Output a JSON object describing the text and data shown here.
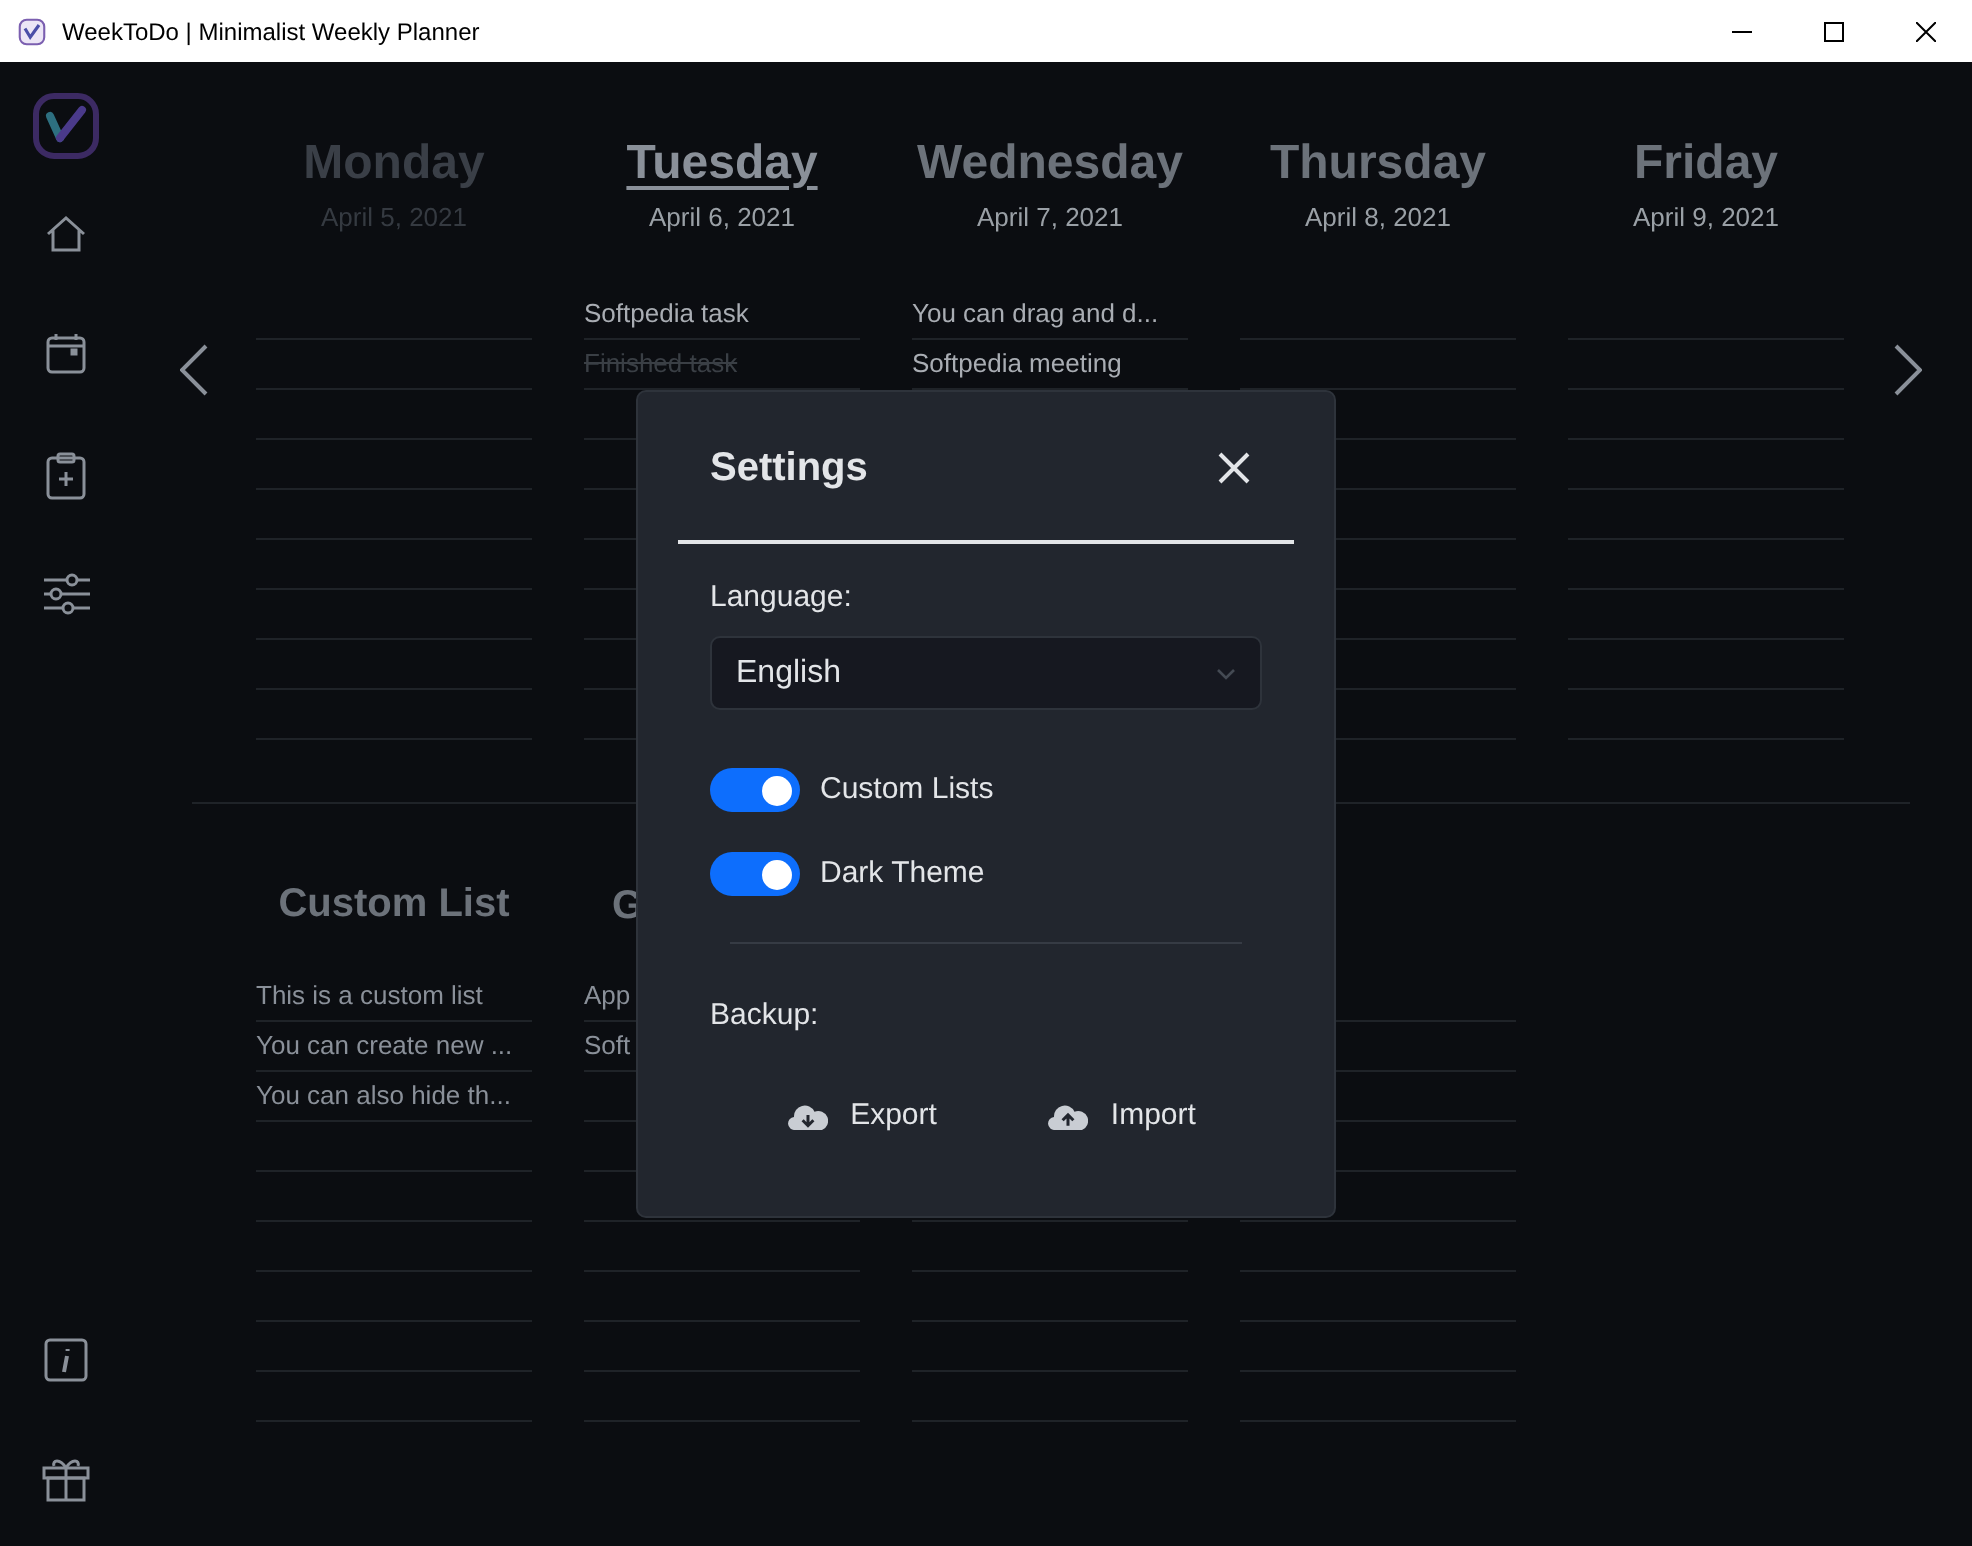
{
  "window": {
    "title": "WeekToDo | Minimalist Weekly Planner"
  },
  "week": {
    "days": [
      {
        "name": "Monday",
        "date": "April 5, 2021",
        "kind": "past"
      },
      {
        "name": "Tuesday",
        "date": "April 6, 2021",
        "kind": "today",
        "tasks": [
          {
            "text": "Softpedia task",
            "done": false
          },
          {
            "text": "Finished task",
            "done": true
          }
        ]
      },
      {
        "name": "Wednesday",
        "date": "April 7, 2021",
        "kind": "upcoming",
        "tasks": [
          {
            "text": "You can drag and d...",
            "done": false
          },
          {
            "text": "Softpedia meeting",
            "done": false
          }
        ]
      },
      {
        "name": "Thursday",
        "date": "April 8, 2021",
        "kind": "upcoming"
      },
      {
        "name": "Friday",
        "date": "April 9, 2021",
        "kind": "upcoming"
      }
    ]
  },
  "custom_lists": [
    {
      "title": "Custom List",
      "tasks": [
        {
          "text": "This is a custom list",
          "done": false
        },
        {
          "text": "You can create new ...",
          "done": false
        },
        {
          "text": "You can also hide th...",
          "done": false
        }
      ]
    },
    {
      "title": "G",
      "tasks": [
        {
          "text": "App",
          "done": false
        },
        {
          "text": "Soft",
          "done": false
        }
      ]
    }
  ],
  "settings_dialog": {
    "title": "Settings",
    "language_label": "Language:",
    "language": "English",
    "toggles": [
      {
        "label": "Custom Lists",
        "on": true
      },
      {
        "label": "Dark Theme",
        "on": true
      }
    ],
    "backup_label": "Backup:",
    "buttons": [
      {
        "label": "Export",
        "kind": "export"
      },
      {
        "label": "Import",
        "kind": "import"
      }
    ]
  }
}
